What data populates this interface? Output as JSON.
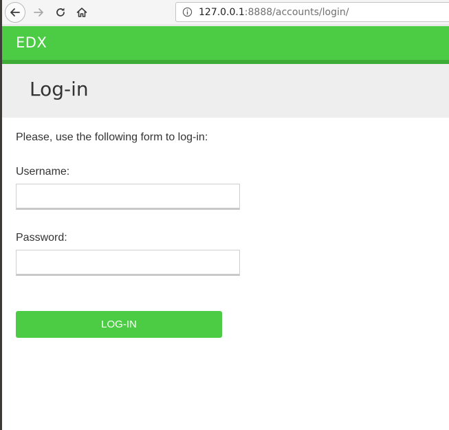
{
  "browser": {
    "url_host": "127.0.0.1",
    "url_rest": ":8888/accounts/login/",
    "icons": {
      "back": "arrow-left-icon",
      "forward": "arrow-right-icon",
      "reload": "reload-icon",
      "home": "home-icon",
      "site_info": "info-icon"
    }
  },
  "site": {
    "brand": "EDX",
    "accent_color": "#4ccc45"
  },
  "page": {
    "title": "Log-in",
    "intro": "Please, use the following form to log-in:"
  },
  "form": {
    "username_label": "Username:",
    "username_value": "",
    "password_label": "Password:",
    "password_value": "",
    "submit_label": "LOG-IN"
  }
}
